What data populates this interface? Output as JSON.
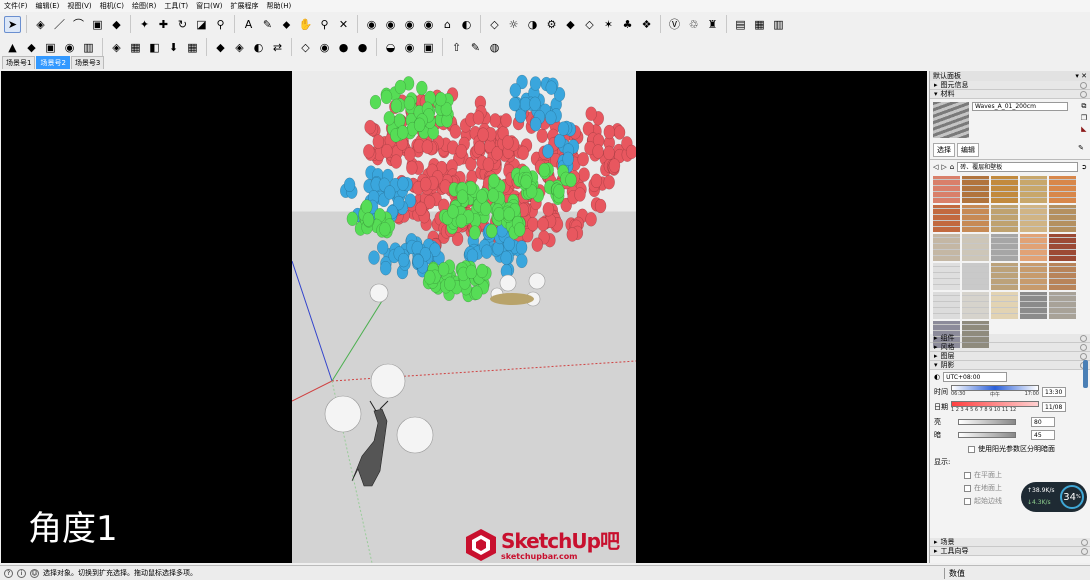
{
  "menu": [
    "文件(F)",
    "编辑(E)",
    "视图(V)",
    "相机(C)",
    "绘图(R)",
    "工具(T)",
    "窗口(W)",
    "扩展程序",
    "帮助(H)"
  ],
  "toolbar_row1": [
    "➤",
    "◈",
    "／",
    "⌒",
    "▣",
    "◆",
    "✦",
    "✚",
    "↻",
    "◪",
    "⚲",
    "A",
    "✎",
    "⬥",
    "✋",
    "⚲",
    "✕",
    "◉",
    "◉",
    "◉",
    "◉",
    "⌂",
    "◐",
    "◇",
    "☼",
    "◑",
    "⚙",
    "◆",
    "◇",
    "✶",
    "♣",
    "❖",
    "Ⓥ",
    "♲",
    "♜",
    "▤",
    "▦",
    "▥"
  ],
  "toolbar_row2": [
    "▲",
    "◆",
    "▣",
    "◉",
    "▥",
    "◈",
    "▦",
    "◧",
    "⬇",
    "▦",
    "◆",
    "◈",
    "◐",
    "⇄",
    "◇",
    "◉",
    "●",
    "●",
    "◒",
    "◉",
    "▣",
    "⇧",
    "✎",
    "◍"
  ],
  "scene_tabs": [
    {
      "label": "场景号1",
      "active": false
    },
    {
      "label": "场景号2",
      "active": true
    },
    {
      "label": "场景号3",
      "active": false
    }
  ],
  "viewport": {
    "angle_label": "角度1"
  },
  "watermark": {
    "brand": "SketchUp",
    "suffix": "吧",
    "url": "sketchupbar.com"
  },
  "panel": {
    "title": "默认面板",
    "entity_info": "图元信息",
    "materials": "材料",
    "material_name": "Waves_A_01_200cm",
    "tab_select": "选择",
    "tab_edit": "编辑",
    "library": "砖、覆层和壁板",
    "swatch_colors": [
      "#d97f6a",
      "#b1743d",
      "#c28a3d",
      "#c8a76b",
      "#d8874a",
      "#c2693f",
      "#c78a55",
      "#bfa26f",
      "#d0b485",
      "#b49060",
      "#c4b7a4",
      "#cdc6b8",
      "#a6a6a6",
      "#e1a276",
      "#9c4a35",
      "#dedede",
      "#c9c9c9",
      "#bca27a",
      "#c79b6d",
      "#b8845a",
      "#dcdcdc",
      "#d6d3cc",
      "#e2d3b3",
      "#8b8b8b",
      "#a8a298",
      "#8c8b9a",
      "#8f8b7d"
    ],
    "components": "组件",
    "styles": "风格",
    "layers": "图层",
    "shadows": "阴影",
    "timezone": "UTC+08:00",
    "time_label": "时间",
    "time_ticks_left": "06:30",
    "time_ticks_mid": "中午",
    "time_ticks_right": "17:00",
    "time_value": "13:30",
    "date_label": "日期",
    "date_months": "1 2 3 4 5 6 7 8 9 10 11 12",
    "date_value": "11/08",
    "light_label": "亮",
    "light_value": "80",
    "dark_label": "暗",
    "dark_value": "45",
    "sun_shading": "使用阳光参数区分明暗面",
    "display_label": "显示:",
    "on_faces": "在平面上",
    "on_ground": "在地面上",
    "from_edges": "起始边线",
    "scenes": "场景",
    "instructor": "工具向导"
  },
  "perf_gauge": {
    "up": "↑38.9",
    "down": "↓4.3",
    "up_unit": "K/s",
    "down_unit": "K/s",
    "percent": "34",
    "percent_unit": "%"
  },
  "status": {
    "hint": "选择对象。切换到扩充选择。拖动鼠标选择多项。",
    "measure_label": "数值"
  },
  "colors": {
    "red_balls": "#e8575f",
    "blue_balls": "#3aa6dd",
    "green_balls": "#56dd56",
    "accent": "#3399ff"
  }
}
